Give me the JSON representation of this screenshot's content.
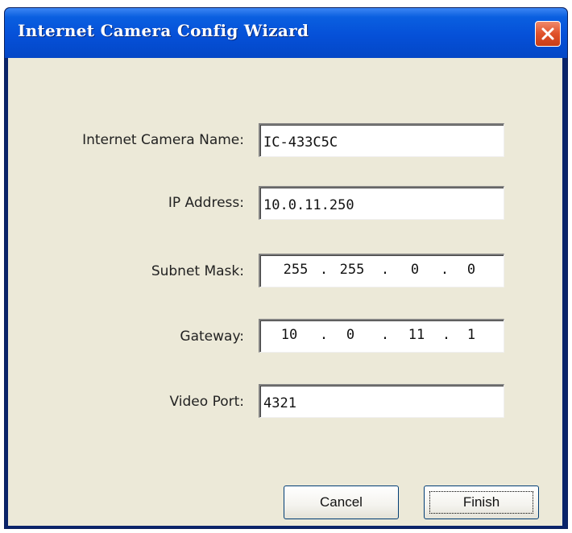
{
  "window": {
    "title": "Internet Camera Config Wizard",
    "close_icon": "close-x-icon"
  },
  "form": {
    "camera_name": {
      "label": "Internet Camera Name:",
      "value": "IC-433C5C"
    },
    "ip_address": {
      "label": "IP Address:",
      "value": "10.0.11.250"
    },
    "subnet_mask": {
      "label": "Subnet Mask:",
      "octets": [
        "255",
        "255",
        "0",
        "0"
      ],
      "separator": "."
    },
    "gateway": {
      "label": "Gateway:",
      "octets": [
        "10",
        "0",
        "11",
        "1"
      ],
      "separator": "."
    },
    "video_port": {
      "label": "Video Port:",
      "value": "4321"
    }
  },
  "buttons": {
    "cancel_label": "Cancel",
    "finish_label": "Finish"
  },
  "colors": {
    "title_bar": "#0550d8",
    "close_button": "#e0512a",
    "dialog_face": "#ece9d8",
    "button_border": "#003c74"
  }
}
